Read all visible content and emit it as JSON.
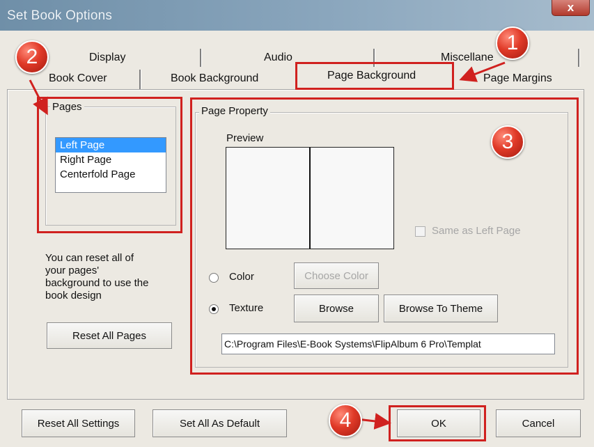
{
  "window": {
    "title": "Set Book Options",
    "close_label": "x"
  },
  "tabs": {
    "row1": [
      "Display",
      "Audio",
      "Miscellane"
    ],
    "row2": [
      "Book Cover",
      "Book Background",
      "Page Background",
      "Page Margins"
    ],
    "active": "Page Background"
  },
  "pages_group": {
    "legend": "Pages",
    "items": [
      "Left Page",
      "Right Page",
      "Centerfold Page"
    ],
    "selected": "Left Page"
  },
  "reset_info": {
    "lines": [
      "You can reset all of",
      "your pages'",
      "background to use the",
      "book design"
    ],
    "button": "Reset All Pages"
  },
  "page_property": {
    "legend": "Page Property",
    "preview_label": "Preview",
    "same_as_left": "Same as Left Page",
    "color_label": "Color",
    "texture_label": "Texture",
    "selected_option": "Texture",
    "choose_color": "Choose Color",
    "browse": "Browse",
    "browse_theme": "Browse To Theme",
    "path": "C:\\Program Files\\E-Book Systems\\FlipAlbum 6 Pro\\Templat"
  },
  "footer": {
    "reset_all": "Reset All Settings",
    "set_default": "Set All As Default",
    "ok": "OK",
    "cancel": "Cancel"
  },
  "annotations": [
    "1",
    "2",
    "3",
    "4"
  ],
  "colors": {
    "highlight": "#d0211f",
    "selection": "#3399ff",
    "dialog_bg": "#ece9e2"
  }
}
